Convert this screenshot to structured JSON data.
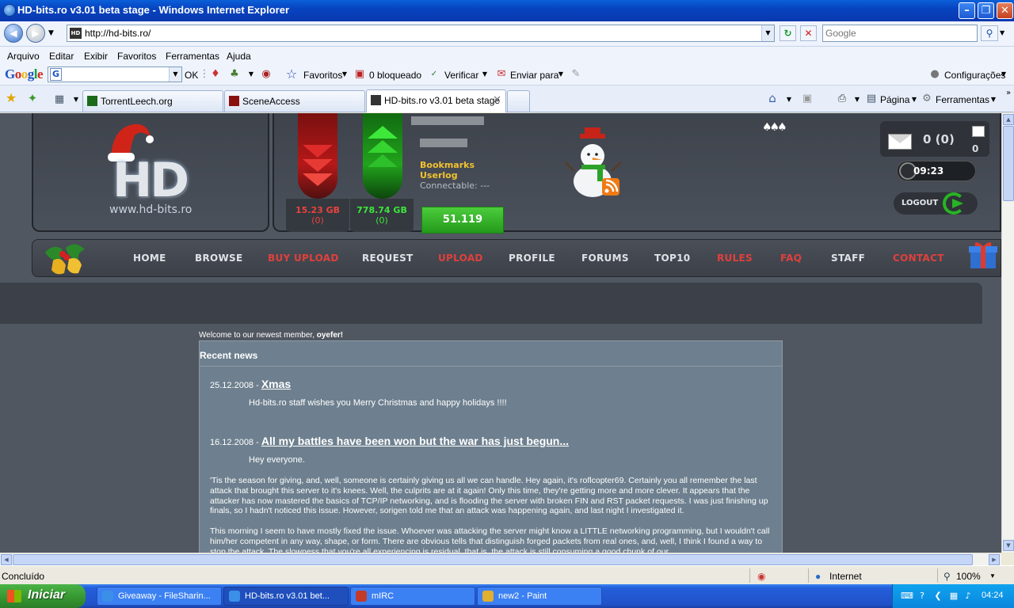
{
  "window": {
    "title": "HD-bits.ro v3.01 beta stage - Windows Internet Explorer",
    "min_glyph": "–",
    "max_glyph": "❐",
    "close_glyph": "✕"
  },
  "address_bar": {
    "url": "http://hd-bits.ro/",
    "favicon_text": "HD",
    "search_placeholder": "Google"
  },
  "menu": [
    "Arquivo",
    "Editar",
    "Exibir",
    "Favoritos",
    "Ferramentas",
    "Ajuda"
  ],
  "google_toolbar": {
    "logo": "Google",
    "ok_label": "OK",
    "favoritos_label": "Favoritos",
    "blocked_label": "0 bloqueado",
    "check_label": "Verificar",
    "send_label": "Enviar para",
    "settings_label": "Configurações"
  },
  "tabs": [
    {
      "label": "TorrentLeech.org",
      "active": false
    },
    {
      "label": "SceneAccess",
      "active": false
    },
    {
      "label": "HD-bits.ro v3.01 beta stage",
      "active": true
    }
  ],
  "command_bar": {
    "page_label": "Página",
    "tools_label": "Ferramentas"
  },
  "site": {
    "logo_text": "HD",
    "logo_url": "www.hd-bits.ro",
    "downloaded": "15.23 GB",
    "downloaded_count": "(0)",
    "uploaded": "778.74 GB",
    "uploaded_count": "(0)",
    "links": [
      "Bookmarks",
      "Userlog"
    ],
    "connectable": "Connectable: ---",
    "ratio": "51.119",
    "messages": "0 (0)",
    "new_messages": "0",
    "clock": "09:23",
    "logout_label": "LOGOUT",
    "bells": "♠♠♠",
    "nav": [
      {
        "label": "HOME",
        "highlight": false
      },
      {
        "label": "BROWSE",
        "highlight": false
      },
      {
        "label": "BUY UPLOAD",
        "highlight": true
      },
      {
        "label": "REQUEST",
        "highlight": false
      },
      {
        "label": "UPLOAD",
        "highlight": true
      },
      {
        "label": "PROFILE",
        "highlight": false
      },
      {
        "label": "FORUMS",
        "highlight": false
      },
      {
        "label": "TOP10",
        "highlight": false
      },
      {
        "label": "RULES",
        "highlight": true
      },
      {
        "label": "FAQ",
        "highlight": true
      },
      {
        "label": "STAFF",
        "highlight": false
      },
      {
        "label": "CONTACT",
        "highlight": true
      }
    ],
    "welcome_prefix": "Welcome to our newest member, ",
    "welcome_member": "oyefer!",
    "news_heading": "Recent news",
    "news": [
      {
        "date": "25.12.2008 - ",
        "title": "Xmas",
        "subtitle": "Hd-bits.ro staff wishes you Merry Christmas and happy holidays !!!!"
      },
      {
        "date": "16.12.2008 - ",
        "title": "All my battles have been won but the war has just begun...",
        "subtitle": "Hey everyone.",
        "para1": "'Tis the season for giving, and, well, someone is certainly giving us all we can handle. Hey again, it's roflcopter69. Certainly you all remember the last attack that brought this server to it's knees. Well, the culprits are at it again! Only this time, they're getting more and more clever. It appears that the attacker has now mastered the basics of TCP/IP networking, and is flooding the server with broken FIN and RST packet requests. I was just finishing up finals, so I hadn't noticed this issue. However, sorigen told me that an attack was happening again, and last night I investigated it.",
        "para2": "This morning I seem to have mostly fixed the issue. Whoever was attacking the server might know a LITTLE networking programming, but I wouldn't call him/her competent in any way, shape, or form. There are obvious tells that distinguish forged packets from real ones, and, well, I think I found a way to stop the attack. The slowness that you're all experiencing is residual, that is, the attack is still consuming a good chunk of our"
      }
    ]
  },
  "status_bar": {
    "status": "Concluído",
    "zone": "Internet",
    "zoom": "100%"
  },
  "taskbar": {
    "start_label": "Iniciar",
    "items": [
      {
        "label": "Giveaway - FileSharin...",
        "active": false
      },
      {
        "label": "HD-bits.ro v3.01 bet...",
        "active": true
      },
      {
        "label": "mIRC",
        "active": false
      },
      {
        "label": "new2 - Paint",
        "active": false
      }
    ],
    "time": "04:24"
  },
  "colors": {
    "nav_highlight": "#e0403c",
    "link_yellow": "#f2c230",
    "download_red": "#e8443c",
    "upload_green": "#3ce63a",
    "ratio_green": "#2fb225"
  }
}
